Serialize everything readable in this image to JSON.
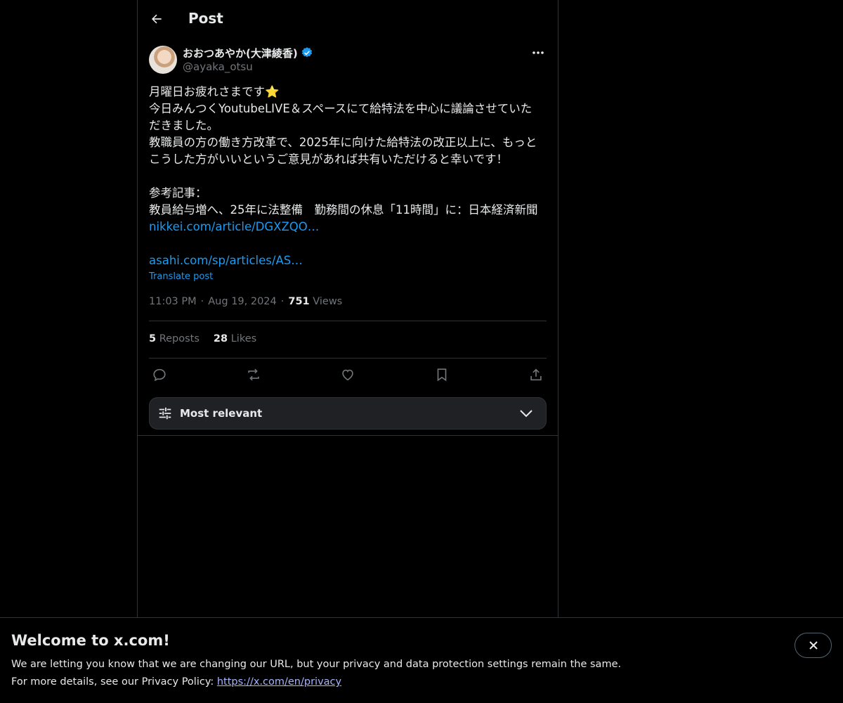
{
  "header": {
    "title": "Post",
    "back_icon": "arrow-left-icon"
  },
  "post": {
    "author": {
      "name": "おおつあやか(大津綾香)",
      "handle": "@ayaka_otsu",
      "verified": true,
      "verified_color": "#1d9bf0"
    },
    "text_lines": [
      "月曜日お疲れさまです⭐",
      "今日みんつくYoutubeLIVE＆スペースにて給特法を中心に議論させていた",
      "だきました。",
      "教職員の方の働き方改革で、2025年に向けた給特法の改正以上に、もっと",
      "こうした方がいいというご意見があれば共有いただけると幸いです！",
      "",
      "参考記事：",
      "教員給与増へ、25年に法整備　勤務間の休息「11時間」に：日本経済新聞"
    ],
    "links": [
      "nikkei.com/article/DGXZQO…",
      "asahi.com/sp/articles/AS…"
    ],
    "translate_label": "Translate post",
    "time": "11:03 PM",
    "date": "Aug 19, 2024",
    "views_count": "751",
    "views_label": "Views",
    "reposts_count": "5",
    "reposts_label": "Reposts",
    "likes_count": "28",
    "likes_label": "Likes"
  },
  "actions": [
    "reply-icon",
    "repost-icon",
    "like-icon",
    "bookmark-icon",
    "share-icon"
  ],
  "sort": {
    "label": "Most relevant"
  },
  "banner": {
    "title": "Welcome to x.com!",
    "line1": "We are letting you know that we are changing our URL, but your privacy and data protection settings remain the same.",
    "line2_prefix": "For more details, see our Privacy Policy: ",
    "link_text": "https://x.com/en/privacy"
  },
  "colors": {
    "background": "#000000",
    "text": "#e7e9ea",
    "muted": "#71767b",
    "accent": "#1d9bf0",
    "border": "#2f3336"
  }
}
